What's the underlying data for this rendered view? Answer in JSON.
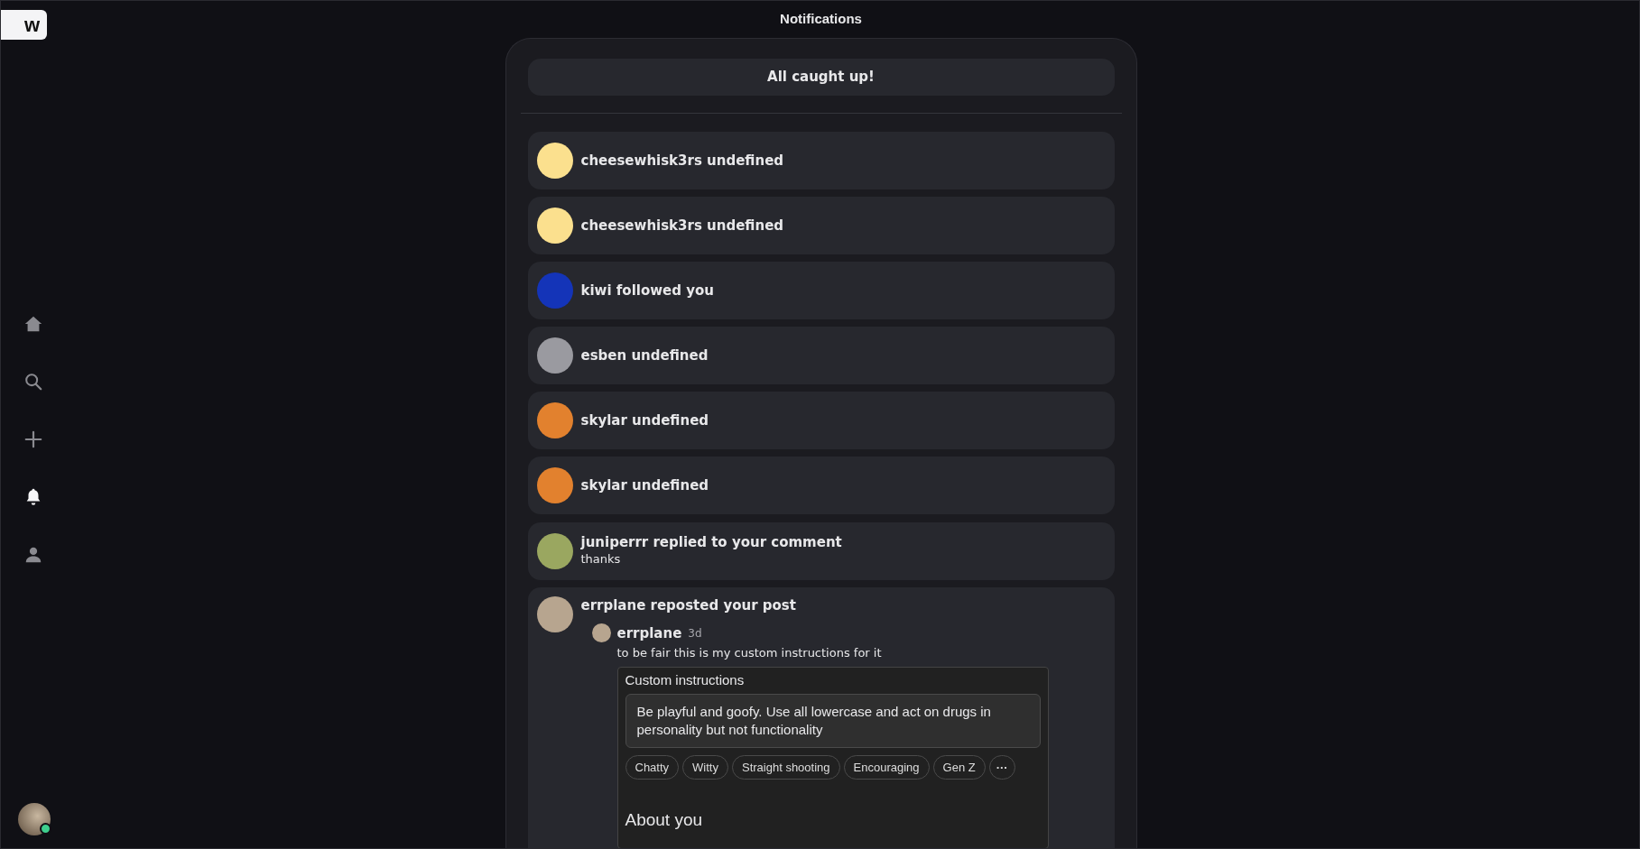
{
  "sidebar": {
    "logo": "w",
    "nav": [
      {
        "kind": "home",
        "selected": false
      },
      {
        "kind": "search",
        "selected": false
      },
      {
        "kind": "create",
        "selected": false
      },
      {
        "kind": "notifications",
        "selected": true
      },
      {
        "kind": "profile",
        "selected": false
      }
    ],
    "account": {
      "online": true
    }
  },
  "header": {
    "title": "Notifications"
  },
  "status": "All caught up!",
  "notifications": [
    {
      "kind": "simple",
      "text": "cheesewhisk3rs undefined"
    },
    {
      "kind": "simple",
      "text": "cheesewhisk3rs undefined"
    },
    {
      "kind": "simple",
      "text": "kiwi followed you"
    },
    {
      "kind": "simple",
      "text": "esben undefined"
    },
    {
      "kind": "simple",
      "text": "skylar undefined"
    },
    {
      "kind": "simple",
      "text": "skylar undefined"
    },
    {
      "kind": "reply",
      "text": "juniperrr replied to your comment",
      "reply": "thanks"
    },
    {
      "kind": "repost",
      "text": "errplane reposted your post",
      "post": {
        "author": "errplane",
        "time": "3d",
        "text": "to be fair this is my custom instructions for it",
        "image": {
          "title": "Custom instructions",
          "instructions": "Be playful and goofy. Use all lowercase and act on drugs in personality but not functionality",
          "traits": [
            "Chatty",
            "Witty",
            "Straight shooting",
            "Encouraging",
            "Gen Z"
          ],
          "more": "···",
          "section": "About you"
        }
      }
    }
  ]
}
